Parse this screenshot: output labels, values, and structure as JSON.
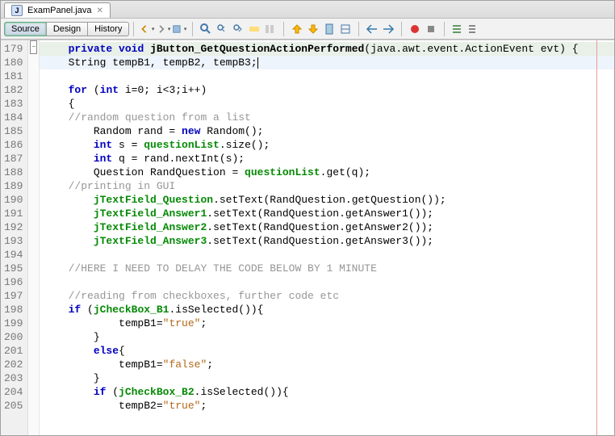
{
  "tab": {
    "filename": "ExamPanel.java"
  },
  "views": {
    "source": "Source",
    "design": "Design",
    "history": "History"
  },
  "lines_start": 179,
  "lines_count": 27,
  "code": {
    "l179": {
      "sig_pre": "private void",
      "sig_name": "jButton_GetQuestionActionPerformed",
      "sig_args": "(java.awt.event.ActionEvent evt) {"
    },
    "l180": "    String tempB1, tempB2, tempB3;",
    "l182_for": "for",
    "l182_rest": " (",
    "l182_int": "int",
    "l182_tail": " i=0; i<3;i++)",
    "l183": "    {",
    "l184": "    //random question from a list",
    "l185_a": "        Random rand = ",
    "l185_new": "new",
    "l185_b": " Random();",
    "l186_a": "        ",
    "l186_int": "int",
    "l186_b": " s = ",
    "l186_f": "questionList",
    "l186_c": ".size();",
    "l187_a": "        ",
    "l187_int": "int",
    "l187_b": " q = rand.nextInt(s);",
    "l188_a": "        Question RandQuestion = ",
    "l188_f": "questionList",
    "l188_b": ".get(q);",
    "l189": "    //printing in GUI",
    "l190_a": "        ",
    "l190_f": "jTextField_Question",
    "l190_b": ".setText(RandQuestion.getQuestion());",
    "l191_a": "        ",
    "l191_f": "jTextField_Answer1",
    "l191_b": ".setText(RandQuestion.getAnswer1());",
    "l192_a": "        ",
    "l192_f": "jTextField_Answer2",
    "l192_b": ".setText(RandQuestion.getAnswer2());",
    "l193_a": "        ",
    "l193_f": "jTextField_Answer3",
    "l193_b": ".setText(RandQuestion.getAnswer3());",
    "l195": "    //HERE I NEED TO DELAY THE CODE BELOW BY 1 MINUTE",
    "l197": "    //reading from checkboxes, further code etc",
    "l198_a": "    ",
    "l198_if": "if",
    "l198_b": " (",
    "l198_f": "jCheckBox_B1",
    "l198_c": ".isSelected()){",
    "l199_a": "            tempB1=",
    "l199_s": "\"true\"",
    "l199_b": ";",
    "l200": "        }",
    "l201_a": "        ",
    "l201_else": "else",
    "l201_b": "{",
    "l202_a": "            tempB1=",
    "l202_s": "\"false\"",
    "l202_b": ";",
    "l203": "        }",
    "l204_a": "        ",
    "l204_if": "if",
    "l204_b": " (",
    "l204_f": "jCheckBox_B2",
    "l204_c": ".isSelected()){",
    "l205_a": "            tempB2=",
    "l205_s": "\"true\"",
    "l205_b": ";"
  }
}
